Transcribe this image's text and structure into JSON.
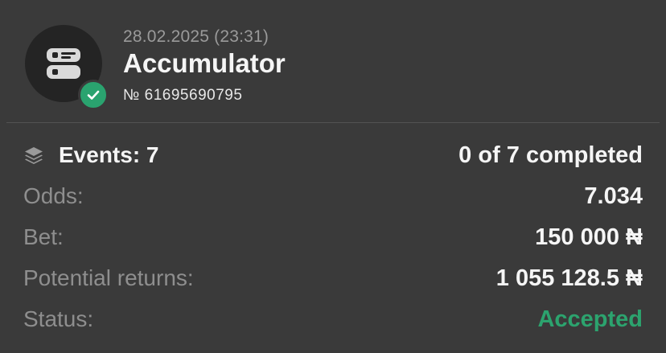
{
  "bet": {
    "date": "28.02.2025 (23:31)",
    "title": "Accumulator",
    "number": "№ 61695690795",
    "icon": "coupon-icon",
    "status_icon": "check-icon"
  },
  "details": {
    "events_label": "Events: 7",
    "events_value": "0 of 7 completed",
    "odds_label": "Odds:",
    "odds_value": "7.034",
    "bet_label": "Bet:",
    "bet_value": "150 000 ₦",
    "returns_label": "Potential returns:",
    "returns_value": "1 055 128.5 ₦",
    "status_label": "Status:",
    "status_value": "Accepted"
  },
  "colors": {
    "background": "#3a3a3a",
    "accent_green": "#2aa36f",
    "avatar_bg": "#242424",
    "label_gray": "#8e8e8e"
  }
}
